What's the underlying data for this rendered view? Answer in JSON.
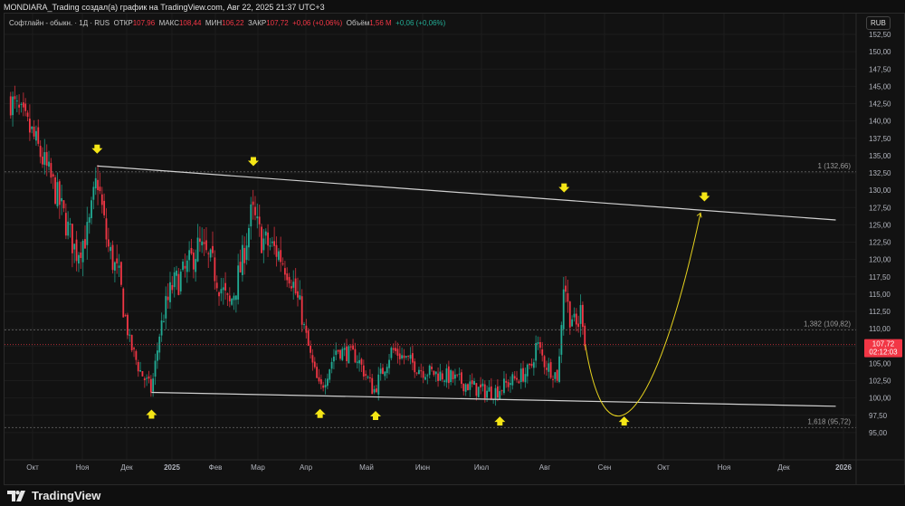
{
  "header": {
    "attribution": "MONDIARA_Trading создал(а) график на TradingView.com, Авг 22, 2025 21:37 UTC+3"
  },
  "legend": {
    "symbol": "Софтлайн - обыкн. · 1Д · RUS",
    "open_label": "ОТКР",
    "open": "107,96",
    "high_label": "МАКС",
    "high": "108,44",
    "low_label": "МИН",
    "low": "106,22",
    "close_label": "ЗАКР",
    "close": "107,72",
    "change": "+0,06 (+0,06%)",
    "volume_label": "Объём",
    "volume": "1,56 M",
    "volume_change": "+0,06 (+0,06%)"
  },
  "currency": "RUB",
  "footer": {
    "brand": "TradingView"
  },
  "colors": {
    "up": "#22ab94",
    "down": "#f23645",
    "trendline": "#d0d0d0",
    "arrow": "#f5e616",
    "projection": "#e6d21e",
    "last_price": "#f23645"
  },
  "chart_data": {
    "type": "candlestick",
    "ylim": [
      92.5,
      152.5
    ],
    "y_ticks": [
      "152,50",
      "150,00",
      "147,50",
      "145,00",
      "142,50",
      "140,00",
      "137,50",
      "135,00",
      "132,50",
      "130,00",
      "127,50",
      "125,00",
      "122,50",
      "120,00",
      "117,50",
      "115,00",
      "112,50",
      "110,00",
      "107,50",
      "105,00",
      "102,50",
      "100,00",
      "97,50",
      "95,00"
    ],
    "x_ticks": [
      "Окт",
      "Ноя",
      "Дек",
      "2025",
      "Фев",
      "Мар",
      "Апр",
      "Май",
      "Июн",
      "Июл",
      "Авг",
      "Сен",
      "Окт",
      "Ноя",
      "Дек",
      "2026"
    ],
    "approx_close_path": [
      [
        "2024-09-18",
        143
      ],
      [
        "2024-10-01",
        138
      ],
      [
        "2024-10-15",
        130
      ],
      [
        "2024-10-28",
        121
      ],
      [
        "2024-11-05",
        124
      ],
      [
        "2024-11-11",
        132
      ],
      [
        "2024-11-18",
        122
      ],
      [
        "2024-11-26",
        117
      ],
      [
        "2024-12-03",
        108
      ],
      [
        "2024-12-10",
        104
      ],
      [
        "2024-12-18",
        101
      ],
      [
        "2024-12-24",
        110
      ],
      [
        "2025-01-01",
        116
      ],
      [
        "2025-01-10",
        118
      ],
      [
        "2025-01-20",
        122
      ],
      [
        "2025-01-30",
        119
      ],
      [
        "2025-02-10",
        113
      ],
      [
        "2025-02-18",
        119
      ],
      [
        "2025-02-25",
        127
      ],
      [
        "2025-03-03",
        123
      ],
      [
        "2025-03-14",
        121
      ],
      [
        "2025-03-22",
        118
      ],
      [
        "2025-03-29",
        112
      ],
      [
        "2025-04-04",
        105
      ],
      [
        "2025-04-08",
        101
      ],
      [
        "2025-04-16",
        107
      ],
      [
        "2025-04-26",
        106
      ],
      [
        "2025-05-05",
        101
      ],
      [
        "2025-05-15",
        107
      ],
      [
        "2025-06-01",
        104
      ],
      [
        "2025-06-15",
        103
      ],
      [
        "2025-07-01",
        101
      ],
      [
        "2025-07-08",
        101
      ],
      [
        "2025-07-16",
        102.5
      ],
      [
        "2025-07-25",
        104
      ],
      [
        "2025-07-28",
        108
      ],
      [
        "2025-08-01",
        105
      ],
      [
        "2025-08-08",
        103
      ],
      [
        "2025-08-11",
        118
      ],
      [
        "2025-08-13",
        113
      ],
      [
        "2025-08-18",
        110
      ],
      [
        "2025-08-20",
        113
      ],
      [
        "2025-08-22",
        107.72
      ]
    ],
    "last_price": {
      "value": "107,72",
      "countdown": "02:12:03"
    },
    "fib_levels": [
      {
        "label": "1 (132,66)",
        "value": 132.66
      },
      {
        "label": "1,382 (109,82)",
        "value": 109.82
      },
      {
        "label": "1,618 (95,72)",
        "value": 95.72
      }
    ],
    "resistance_line": [
      [
        "2024-11-11",
        133.5
      ],
      [
        "2025-12-28",
        125.7
      ]
    ],
    "support_line": [
      [
        "2024-12-18",
        100.8
      ],
      [
        "2025-12-28",
        98.8
      ]
    ],
    "projection": [
      [
        "2025-08-22",
        107.7
      ],
      [
        "2025-09-10",
        99.5
      ],
      [
        "2025-10-20",
        126.7
      ]
    ],
    "down_arrows": [
      [
        "2024-11-11",
        135.8
      ],
      [
        "2025-02-26",
        134
      ],
      [
        "2025-08-11",
        130.2
      ],
      [
        "2025-10-22",
        128.9
      ]
    ],
    "up_arrows": [
      [
        "2024-12-18",
        97.8
      ],
      [
        "2025-04-08",
        97.9
      ],
      [
        "2025-05-06",
        97.6
      ],
      [
        "2025-07-10",
        96.8
      ],
      [
        "2025-09-11",
        96.8
      ]
    ]
  }
}
